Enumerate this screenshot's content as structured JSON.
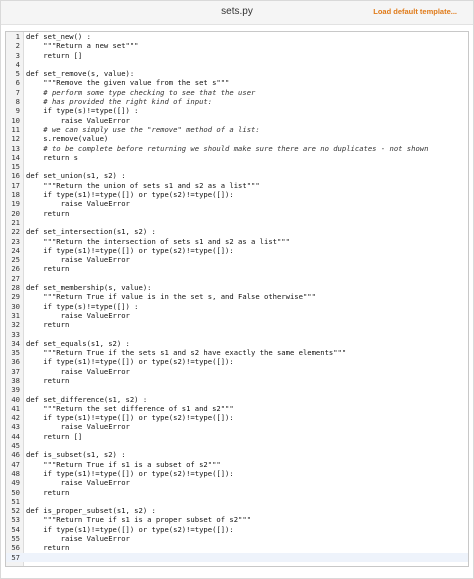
{
  "window": {
    "title": "sets.py",
    "load_template_label": "Load default template..."
  },
  "editor": {
    "lines": [
      {
        "n": "1",
        "text": "def set_new() :"
      },
      {
        "n": "2",
        "text": "    \"\"\"Return a new set\"\"\""
      },
      {
        "n": "3",
        "text": "    return []"
      },
      {
        "n": "4",
        "text": ""
      },
      {
        "n": "5",
        "text": "def set_remove(s, value):"
      },
      {
        "n": "6",
        "text": "    \"\"\"Remove the given value from the set s\"\"\""
      },
      {
        "n": "7",
        "text": "    # perform some type checking to see that the user"
      },
      {
        "n": "8",
        "text": "    # has provided the right kind of input:"
      },
      {
        "n": "9",
        "text": "    if type(s)!=type([]) :"
      },
      {
        "n": "10",
        "text": "        raise ValueError"
      },
      {
        "n": "11",
        "text": "    # we can simply use the \"remove\" method of a list:"
      },
      {
        "n": "12",
        "text": "    s.remove(value)"
      },
      {
        "n": "13",
        "text": "    # to be complete before returning we should make sure there are no duplicates - not shown"
      },
      {
        "n": "14",
        "text": "    return s"
      },
      {
        "n": "15",
        "text": ""
      },
      {
        "n": "16",
        "text": "def set_union(s1, s2) :"
      },
      {
        "n": "17",
        "text": "    \"\"\"Return the union of sets s1 and s2 as a list\"\"\""
      },
      {
        "n": "18",
        "text": "    if type(s1)!=type([]) or type(s2)!=type([]):"
      },
      {
        "n": "19",
        "text": "        raise ValueError"
      },
      {
        "n": "20",
        "text": "    return"
      },
      {
        "n": "21",
        "text": ""
      },
      {
        "n": "22",
        "text": "def set_intersection(s1, s2) :"
      },
      {
        "n": "23",
        "text": "    \"\"\"Return the intersection of sets s1 and s2 as a list\"\"\""
      },
      {
        "n": "24",
        "text": "    if type(s1)!=type([]) or type(s2)!=type([]):"
      },
      {
        "n": "25",
        "text": "        raise ValueError"
      },
      {
        "n": "26",
        "text": "    return"
      },
      {
        "n": "27",
        "text": ""
      },
      {
        "n": "28",
        "text": "def set_membership(s, value):"
      },
      {
        "n": "29",
        "text": "    \"\"\"Return True if value is in the set s, and False otherwise\"\"\""
      },
      {
        "n": "30",
        "text": "    if type(s)!=type([]) :"
      },
      {
        "n": "31",
        "text": "        raise ValueError"
      },
      {
        "n": "32",
        "text": "    return"
      },
      {
        "n": "33",
        "text": ""
      },
      {
        "n": "34",
        "text": "def set_equals(s1, s2) :"
      },
      {
        "n": "35",
        "text": "    \"\"\"Return True if the sets s1 and s2 have exactly the same elements\"\"\""
      },
      {
        "n": "36",
        "text": "    if type(s1)!=type([]) or type(s2)!=type([]):"
      },
      {
        "n": "37",
        "text": "        raise ValueError"
      },
      {
        "n": "38",
        "text": "    return"
      },
      {
        "n": "39",
        "text": ""
      },
      {
        "n": "40",
        "text": "def set_difference(s1, s2) :"
      },
      {
        "n": "41",
        "text": "    \"\"\"Return the set difference of s1 and s2\"\"\""
      },
      {
        "n": "42",
        "text": "    if type(s1)!=type([]) or type(s2)!=type([]):"
      },
      {
        "n": "43",
        "text": "        raise ValueError"
      },
      {
        "n": "44",
        "text": "    return []"
      },
      {
        "n": "45",
        "text": ""
      },
      {
        "n": "46",
        "text": "def is_subset(s1, s2) :"
      },
      {
        "n": "47",
        "text": "    \"\"\"Return True if s1 is a subset of s2\"\"\""
      },
      {
        "n": "48",
        "text": "    if type(s1)!=type([]) or type(s2)!=type([]):"
      },
      {
        "n": "49",
        "text": "        raise ValueError"
      },
      {
        "n": "50",
        "text": "    return"
      },
      {
        "n": "51",
        "text": ""
      },
      {
        "n": "52",
        "text": "def is_proper_subset(s1, s2) :"
      },
      {
        "n": "53",
        "text": "    \"\"\"Return True if s1 is a proper subset of s2\"\"\""
      },
      {
        "n": "54",
        "text": "    if type(s1)!=type([]) or type(s2)!=type([]):"
      },
      {
        "n": "55",
        "text": "        raise ValueError"
      },
      {
        "n": "56",
        "text": "    return"
      },
      {
        "n": "57",
        "text": ""
      }
    ],
    "active_line": "57"
  }
}
